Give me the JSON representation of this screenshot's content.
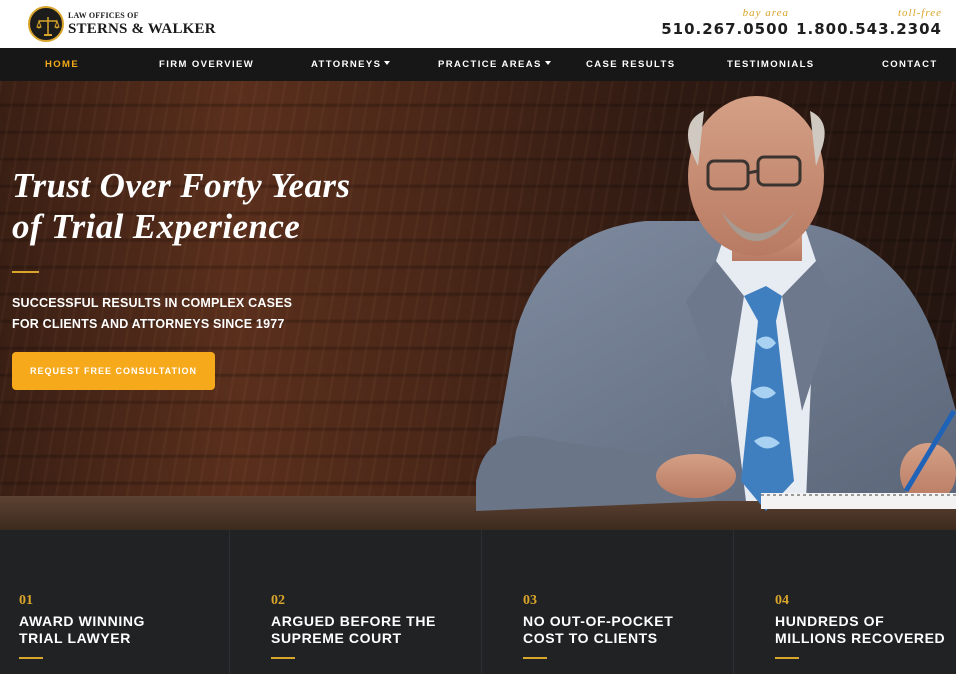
{
  "header": {
    "logo_small": "LAW OFFICES OF",
    "logo_big": "STERNS & WALKER",
    "phones": [
      {
        "label": "bay area",
        "number": "510.267.0500"
      },
      {
        "label": "toll-free",
        "number": "1.800.543.2304"
      }
    ]
  },
  "nav": {
    "items": [
      {
        "label": "HOME",
        "active": true
      },
      {
        "label": "FIRM OVERVIEW"
      },
      {
        "label": "ATTORNEYS",
        "dropdown": true
      },
      {
        "label": "PRACTICE AREAS",
        "dropdown": true
      },
      {
        "label": "CASE RESULTS"
      },
      {
        "label": "TESTIMONIALS"
      },
      {
        "label": "CONTACT"
      }
    ]
  },
  "hero": {
    "title_line1": "Trust Over Forty Years",
    "title_line2": "of Trial Experience",
    "sub_line1": "SUCCESSFUL RESULTS IN COMPLEX CASES",
    "sub_line2": "FOR CLIENTS AND ATTORNEYS SINCE 1977",
    "cta_label": "REQUEST FREE CONSULTATION"
  },
  "features": [
    {
      "num": "01",
      "line1": "AWARD WINNING",
      "line2": "TRIAL LAWYER"
    },
    {
      "num": "02",
      "line1": "ARGUED BEFORE THE",
      "line2": "SUPREME COURT"
    },
    {
      "num": "03",
      "line1": "NO OUT-OF-POCKET",
      "line2": "COST TO CLIENTS"
    },
    {
      "num": "04",
      "line1": "HUNDREDS OF",
      "line2": "MILLIONS RECOVERED"
    }
  ],
  "colors": {
    "accent": "#f7a91c",
    "gold": "#d9a52b",
    "nav_bg": "#171717",
    "feature_bg": "#212224"
  }
}
